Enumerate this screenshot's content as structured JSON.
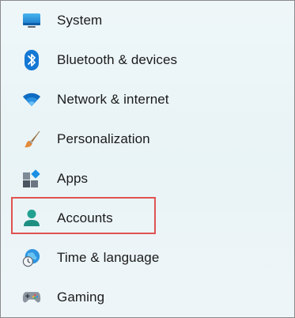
{
  "nav": {
    "items": [
      {
        "label": "System",
        "icon": "system-icon"
      },
      {
        "label": "Bluetooth & devices",
        "icon": "bluetooth-icon"
      },
      {
        "label": "Network & internet",
        "icon": "wifi-icon"
      },
      {
        "label": "Personalization",
        "icon": "paintbrush-icon"
      },
      {
        "label": "Apps",
        "icon": "apps-icon"
      },
      {
        "label": "Accounts",
        "icon": "person-icon"
      },
      {
        "label": "Time & language",
        "icon": "globe-clock-icon"
      },
      {
        "label": "Gaming",
        "icon": "gamepad-icon"
      }
    ]
  },
  "highlight": {
    "target": "Accounts",
    "color": "#e05252"
  },
  "colors": {
    "accent_blue": "#0f7bd6",
    "accent_teal": "#1f9c8f",
    "highlight_red": "#e05252"
  }
}
